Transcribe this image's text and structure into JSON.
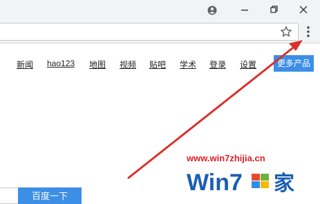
{
  "nav": {
    "items": [
      {
        "label": "新闻"
      },
      {
        "label": "hao123"
      },
      {
        "label": "地图"
      },
      {
        "label": "视频"
      },
      {
        "label": "贴吧"
      },
      {
        "label": "学术"
      },
      {
        "label": "登录"
      },
      {
        "label": "设置"
      }
    ],
    "more_label": "更多产品"
  },
  "search": {
    "button_label": "百度一下"
  },
  "watermark": {
    "url": "www.win7zhijia.cn",
    "logo_text_a": "Win7",
    "logo_text_b": "家"
  },
  "colors": {
    "accent": "#3c8ee6",
    "arrow": "#d9312b",
    "watermark": "#1a5fb4"
  }
}
